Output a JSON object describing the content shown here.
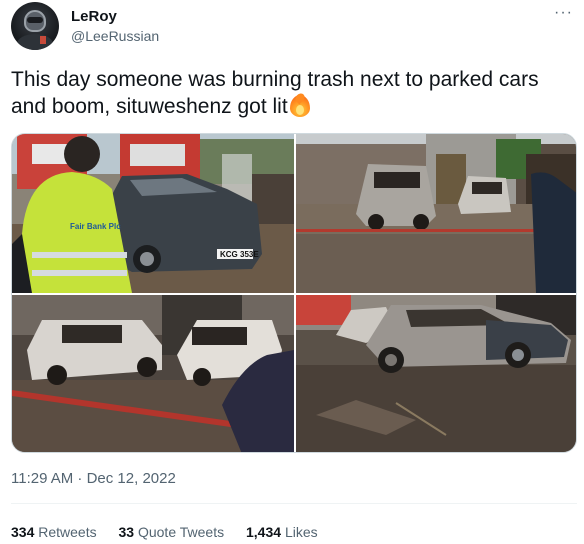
{
  "author": {
    "display_name": "LeRoy",
    "handle": "@LeeRussian",
    "avatar_icon": "avatar-helmet"
  },
  "menu_icon": "more-horizontal-icon",
  "menu_glyph": "···",
  "tweet": {
    "text": "This day someone was burning trash next to parked cars and boom, situweshenz got lit",
    "emoji": "fire-emoji"
  },
  "media": {
    "photos": [
      {
        "content": "firefighter in reflective vest beside dark grey sedan with fire trucks behind",
        "vest_text": "Fair Bank Plc",
        "plate": "KCG 353E"
      },
      {
        "content": "two burnt-out car shells in a yard with red fire hose"
      },
      {
        "content": "two burnt white cars with fire hose on wet ground"
      },
      {
        "content": "fire-damaged grey sedan beside burnt white car"
      }
    ]
  },
  "timestamp": "11:29 AM · Dec 12, 2022",
  "stats": {
    "retweets_count": "334",
    "retweets_label": "Retweets",
    "quotes_count": "33",
    "quotes_label": "Quote Tweets",
    "likes_count": "1,434",
    "likes_label": "Likes"
  },
  "colors": {
    "text_primary": "#0f1419",
    "text_secondary": "#536471",
    "border": "#cfd9de"
  }
}
